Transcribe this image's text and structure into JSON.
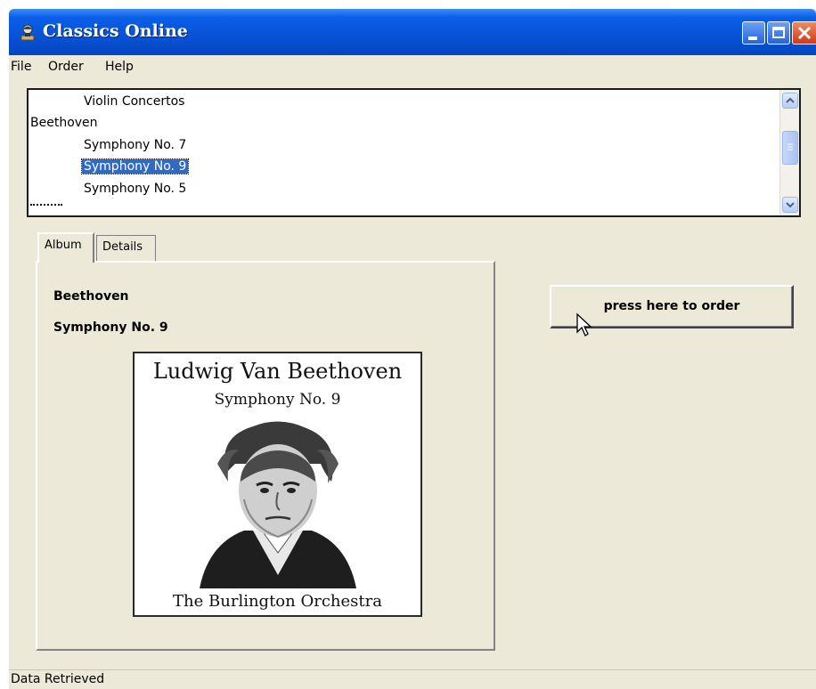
{
  "window": {
    "title": "Classics Online"
  },
  "menu": [
    "File",
    "Order",
    "Help"
  ],
  "tree": {
    "items": [
      {
        "label": "Violin Concertos",
        "level": 1,
        "selected": false
      },
      {
        "label": "Beethoven",
        "level": 0,
        "selected": false
      },
      {
        "label": "Symphony No. 7",
        "level": 1,
        "selected": false
      },
      {
        "label": "Symphony No. 9",
        "level": 1,
        "selected": true
      },
      {
        "label": "Symphony No. 5",
        "level": 1,
        "selected": false
      }
    ]
  },
  "tabs": [
    "Album",
    "Details"
  ],
  "album": {
    "composer": "Beethoven",
    "work": "Symphony No. 9",
    "cover": {
      "title": "Ludwig Van Beethoven",
      "subtitle": "Symphony No. 9",
      "performer": "The Burlington Orchestra"
    }
  },
  "order_button": "press here to order",
  "status": "Data Retrieved",
  "colors": {
    "titlebar": "#0852d6",
    "selection": "#316ac5",
    "face": "#ece9d8"
  }
}
